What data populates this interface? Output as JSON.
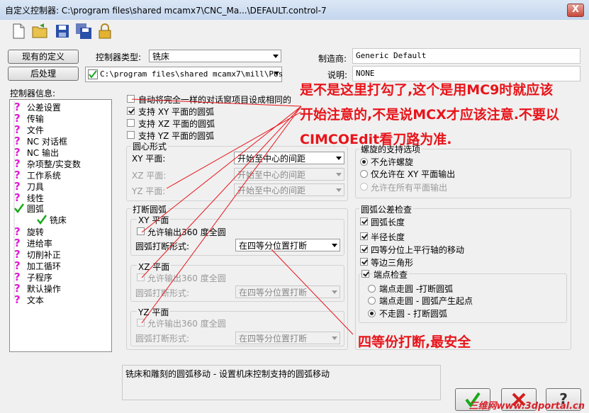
{
  "window": {
    "title": "自定义控制器: C:\\program files\\shared mcamx7\\CNC_Ma...\\DEFAULT.control-7",
    "close": "X"
  },
  "toolbar": {
    "icons": [
      "new-file-icon",
      "open-folder-icon",
      "save-icon",
      "save-all-icon",
      "lock-icon"
    ]
  },
  "top": {
    "current_def_btn": "现有的定义",
    "post_btn": "后处理",
    "controller_type_label": "控制器类型:",
    "controller_type_value": "铣床",
    "post_path": "C:\\program files\\shared mcamx7\\mill\\Pos",
    "manufacturer_label": "制造商:",
    "manufacturer_value": "Generic Default",
    "desc_label": "说明:",
    "desc_value": "NONE"
  },
  "tree": {
    "header": "控制器信息:",
    "items": [
      "公差设置",
      "传输",
      "文件",
      "NC 对话框",
      "NC 输出",
      "杂项整/实变数",
      "工作系统",
      "刀具",
      "线性",
      "圆弧",
      "铣床",
      "旋转",
      "进给率",
      "切削补正",
      "加工循环",
      "子程序",
      "默认操作",
      "文本"
    ]
  },
  "options": {
    "auto_same": "自动将完全一样的对话窗项目设成相同的",
    "xy": "支持 XY 平面的圆弧",
    "xz": "支持 XZ 平面的圆弧",
    "yz": "支持 YZ 平面的圆弧"
  },
  "center": {
    "group": "圆心形式",
    "xy_label": "XY 平面:",
    "xz_label": "XZ 平面:",
    "yz_label": "YZ 平面:",
    "value": "开始至中心的间距"
  },
  "spiral": {
    "group": "螺旋的支持选项",
    "opt1": "不允许螺旋",
    "opt2": "仅允许在 XY 平面输出",
    "opt3": "允许在所有平面输出"
  },
  "breakarc": {
    "group": "打断圆弧",
    "xy_title": "XY 平面",
    "xz_title": "XZ 平面",
    "yz_title": "YZ 平面",
    "allow360": "允许输出360 度全圆",
    "form_label": "圆弧打断形式:",
    "form_value": "在四等分位置打断"
  },
  "tol": {
    "group": "圆弧公差检查",
    "arc_len": "圆弧长度",
    "radius_len": "半径长度",
    "quad_move": "四等分位上平行轴的移动",
    "equi_tri": "等边三角形",
    "endpoint": "端点检查",
    "ep1": "端点走圆 -打断圆弧",
    "ep2": "端点走圆 - 圆弧产生起点",
    "ep3": "不走圆 - 打断圆弧"
  },
  "annotation": {
    "line1": "是不是这里打勾了,这个是用MC9时就应该",
    "line2": "开始注意的,不是说MCX才应该注意.不要以",
    "line3": "CIMCOEdit看刀路为准.",
    "note2": "四等份打断,最安全"
  },
  "status_desc": "铣床和雕刻的圆弧移动 - 设置机床控制支持的圆弧移动",
  "buttons": {
    "ok": "✔",
    "cancel": "✖",
    "help": "?"
  },
  "watermark": "三维网www.3dportal.cn",
  "colors": {
    "annotation": "#e8141a",
    "qmark": "#e01bd6",
    "check_green": "#1aa81a"
  }
}
